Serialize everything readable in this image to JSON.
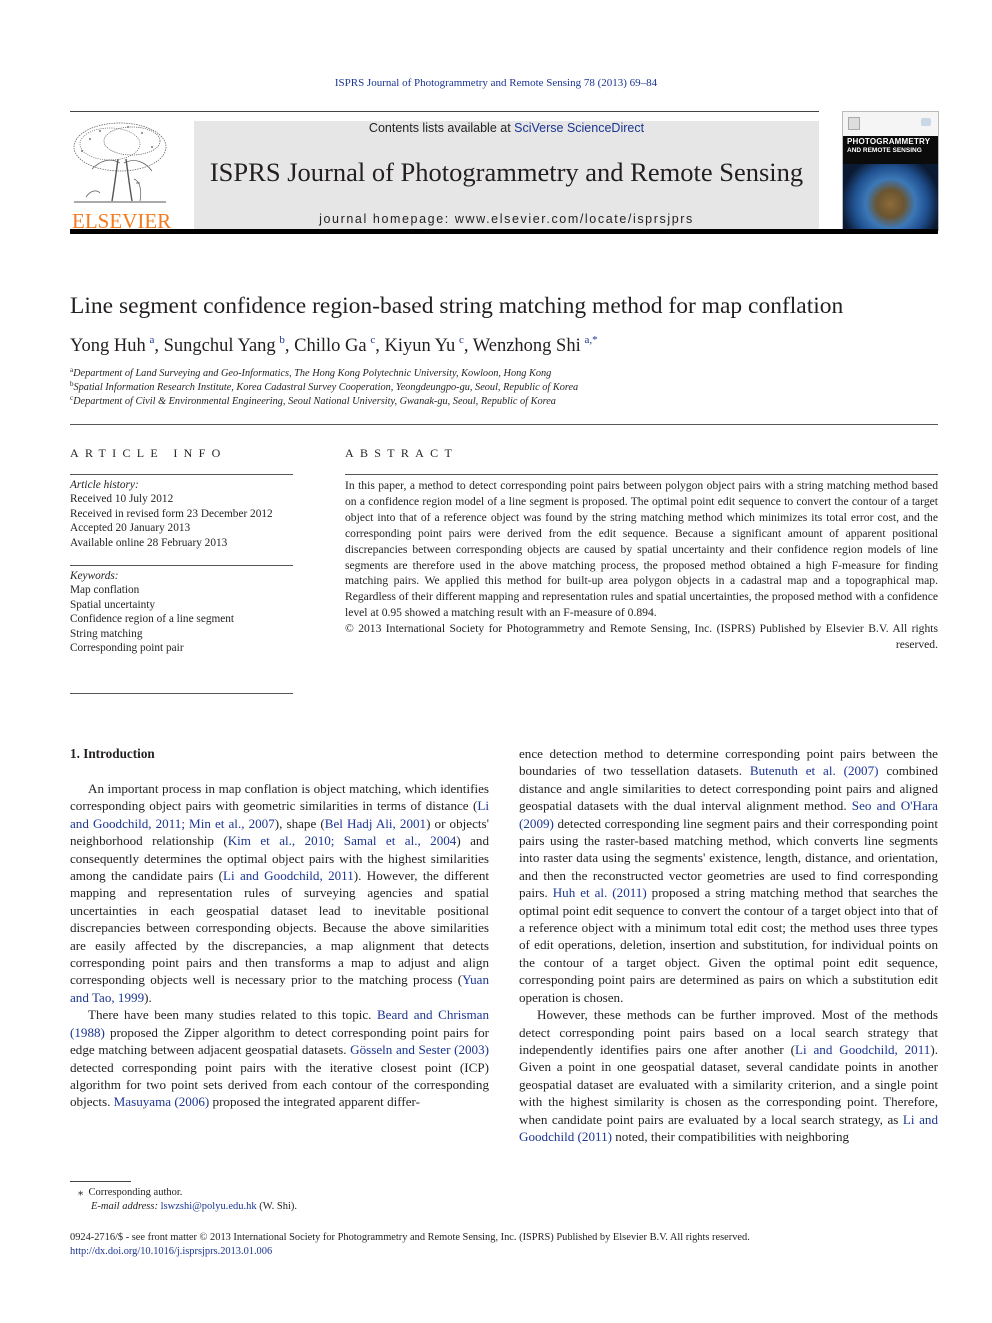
{
  "running_head": "ISPRS Journal of Photogrammetry and Remote Sensing 78 (2013) 69–84",
  "publisher": {
    "logo_word": "ELSEVIER",
    "logo_color": "#f47b20"
  },
  "banner": {
    "contents_prefix": "Contents lists available at ",
    "contents_link": "SciVerse ScienceDirect",
    "journal_title": "ISPRS Journal of Photogrammetry and Remote Sensing",
    "homepage_prefix": "journal homepage: ",
    "homepage_url": "www.elsevier.com/locate/isprsjprs"
  },
  "cover": {
    "title_line1": "PHOTOGRAMMETRY",
    "title_line2": "AND REMOTE SENSING"
  },
  "article": {
    "title": "Line segment confidence region-based string matching method for map conflation",
    "authors": [
      {
        "name": "Yong Huh",
        "sup": "a"
      },
      {
        "name": "Sungchul Yang",
        "sup": "b"
      },
      {
        "name": "Chillo Ga",
        "sup": "c"
      },
      {
        "name": "Kiyun Yu",
        "sup": "c"
      },
      {
        "name": "Wenzhong Shi",
        "sup": "a,*"
      }
    ],
    "affiliations": [
      {
        "sup": "a",
        "text": "Department of Land Surveying and Geo-Informatics, The Hong Kong Polytechnic University, Kowloon, Hong Kong"
      },
      {
        "sup": "b",
        "text": "Spatial Information Research Institute, Korea Cadastral Survey Cooperation, Yeongdeungpo-gu, Seoul, Republic of Korea"
      },
      {
        "sup": "c",
        "text": "Department of Civil & Environmental Engineering, Seoul National University, Gwanak-gu, Seoul, Republic of Korea"
      }
    ]
  },
  "article_info": {
    "heading": "ARTICLE INFO",
    "history_label": "Article history:",
    "history": [
      "Received 10 July 2012",
      "Received in revised form 23 December 2012",
      "Accepted 20 January 2013",
      "Available online 28 February 2013"
    ],
    "keywords_label": "Keywords:",
    "keywords": [
      "Map conflation",
      "Spatial uncertainty",
      "Confidence region of a line segment",
      "String matching",
      "Corresponding point pair"
    ]
  },
  "abstract": {
    "heading": "ABSTRACT",
    "text": "In this paper, a method to detect corresponding point pairs between polygon object pairs with a string matching method based on a confidence region model of a line segment is proposed. The optimal point edit sequence to convert the contour of a target object into that of a reference object was found by the string matching method which minimizes its total error cost, and the corresponding point pairs were derived from the edit sequence. Because a significant amount of apparent positional discrepancies between corresponding objects are caused by spatial uncertainty and their confidence region models of line segments are therefore used in the above matching process, the proposed method obtained a high F-measure for finding matching pairs. We applied this method for built-up area polygon objects in a cadastral map and a topographical map. Regardless of their different mapping and representation rules and spatial uncertainties, the proposed method with a confidence level at 0.95 showed a matching result with an F-measure of 0.894.",
    "copyright": "© 2013 International Society for Photogrammetry and Remote Sensing, Inc. (ISPRS) Published by Elsevier B.V. All rights reserved."
  },
  "intro": {
    "heading": "1. Introduction",
    "left_col": {
      "p1": [
        {
          "t": "An important process in map conflation is object matching, which identifies corresponding object pairs with geometric similarities in terms of distance ("
        },
        {
          "l": "Li and Goodchild, 2011; Min et al., 2007"
        },
        {
          "t": "), shape ("
        },
        {
          "l": "Bel Hadj Ali, 2001"
        },
        {
          "t": ") or objects' neighborhood relationship ("
        },
        {
          "l": "Kim et al., 2010; Samal et al., 2004"
        },
        {
          "t": ") and consequently determines the optimal object pairs with the highest similarities among the candidate pairs ("
        },
        {
          "l": "Li and Goodchild, 2011"
        },
        {
          "t": "). However, the different mapping and representation rules of surveying agencies and spatial uncertainties in each geospatial dataset lead to inevitable positional discrepancies between corresponding objects. Because the above similarities are easily affected by the discrepancies, a map alignment that detects corresponding point pairs and then transforms a map to adjust and align corresponding objects well is necessary prior to the matching process ("
        },
        {
          "l": "Yuan and Tao, 1999"
        },
        {
          "t": ")."
        }
      ],
      "p2": [
        {
          "t": "There have been many studies related to this topic. "
        },
        {
          "l": "Beard and Chrisman (1988)"
        },
        {
          "t": " proposed the Zipper algorithm to detect corresponding point pairs for edge matching between adjacent geospatial datasets. "
        },
        {
          "l": "Gösseln and Sester (2003)"
        },
        {
          "t": " detected corresponding point pairs with the iterative closest point (ICP) algorithm for two point sets derived from each contour of the corresponding objects. "
        },
        {
          "l": "Masuyama (2006)"
        },
        {
          "t": " proposed the integrated apparent differ-"
        }
      ]
    },
    "right_col": {
      "p1": [
        {
          "t": "ence detection method to determine corresponding point pairs between the boundaries of two tessellation datasets. "
        },
        {
          "l": "Butenuth et al. (2007)"
        },
        {
          "t": " combined distance and angle similarities to detect corresponding point pairs and aligned geospatial datasets with the dual interval alignment method. "
        },
        {
          "l": "Seo and O'Hara (2009)"
        },
        {
          "t": " detected corresponding line segment pairs and their corresponding point pairs using the raster-based matching method, which converts line segments into raster data using the segments' existence, length, distance, and orientation, and then the reconstructed vector geometries are used to find corresponding pairs. "
        },
        {
          "l": "Huh et al. (2011)"
        },
        {
          "t": " proposed a string matching method that searches the optimal point edit sequence to convert the contour of a target object into that of a reference object with a minimum total edit cost; the method uses three types of edit operations, deletion, insertion and substitution, for individual points on the contour of a target object. Given the optimal point edit sequence, corresponding point pairs are determined as pairs on which a substitution edit operation is chosen."
        }
      ],
      "p2": [
        {
          "t": "However, these methods can be further improved. Most of the methods detect corresponding point pairs based on a local search strategy that independently identifies pairs one after another ("
        },
        {
          "l": "Li and Goodchild, 2011"
        },
        {
          "t": "). Given a point in one geospatial dataset, several candidate points in another geospatial dataset are evaluated with a similarity criterion, and a single point with the highest similarity is chosen as the corresponding point. Therefore, when candidate point pairs are evaluated by a local search strategy, as "
        },
        {
          "l": "Li and Goodchild (2011)"
        },
        {
          "t": " noted, their compatibilities with neighboring"
        }
      ]
    }
  },
  "footnote": {
    "marker": "⁎",
    "corresponding": "Corresponding author.",
    "email_label": "E-mail address:",
    "email": "lswzshi@polyu.edu.hk",
    "email_suffix": " (W. Shi)."
  },
  "bottom": {
    "issn_line": "0924-2716/$ - see front matter © 2013 International Society for Photogrammetry and Remote Sensing, Inc. (ISPRS) Published by Elsevier B.V. All rights reserved.",
    "doi": "http://dx.doi.org/10.1016/j.isprsjprs.2013.01.006"
  },
  "colors": {
    "link": "#1b3592",
    "text": "#231f20",
    "banner_bg": "#e6e6e6",
    "elsevier_orange": "#f47b20"
  }
}
